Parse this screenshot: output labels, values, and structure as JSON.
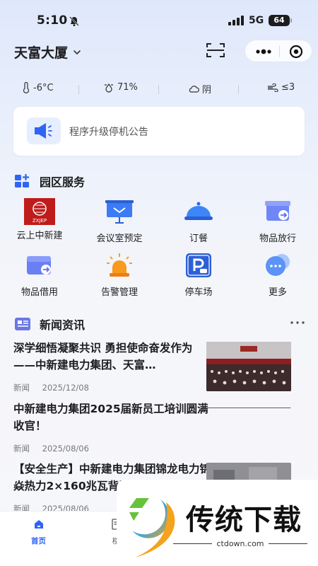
{
  "status": {
    "time": "5:10",
    "network": "5G",
    "battery": "64"
  },
  "header": {
    "building": "天富大厦"
  },
  "weather": {
    "temperature": "-6°C",
    "humidity": "71%",
    "condition": "阴",
    "wind": "≤3"
  },
  "notice": {
    "text": "程序升级停机公告"
  },
  "services": {
    "title": "园区服务",
    "items": [
      {
        "label": "云上中新建",
        "icon": "zxjep-logo"
      },
      {
        "label": "会议室预定",
        "icon": "presentation-icon"
      },
      {
        "label": "订餐",
        "icon": "dish-cover-icon"
      },
      {
        "label": "物品放行",
        "icon": "box-release-icon"
      },
      {
        "label": "物品借用",
        "icon": "box-borrow-icon"
      },
      {
        "label": "告警管理",
        "icon": "alarm-light-icon"
      },
      {
        "label": "停车场",
        "icon": "parking-icon"
      },
      {
        "label": "更多",
        "icon": "more-chat-icon"
      }
    ],
    "logo_text": "ZXJEP"
  },
  "news": {
    "title": "新闻资讯",
    "items": [
      {
        "title": "深学细悟凝聚共识 勇担使命奋发作为——中新建电力集团、天富…",
        "category": "新闻",
        "date": "2025/12/08"
      },
      {
        "title": "中新建电力集团2025届新员工培训圆满收官！",
        "category": "新闻",
        "date": "2025/08/06"
      },
      {
        "title": "【安全生产】中新建电力集团锦龙电力锦焱热力2×160兆瓦背压供…",
        "category": "新闻",
        "date": "2025/08/06"
      }
    ]
  },
  "tabbar": {
    "items": [
      {
        "label": "首页"
      },
      {
        "label": "楼"
      }
    ]
  },
  "watermark": {
    "text": "传统下载",
    "url": "ctdown.com"
  },
  "colors": {
    "accent": "#2f64f4",
    "background": "#eef2fb"
  }
}
